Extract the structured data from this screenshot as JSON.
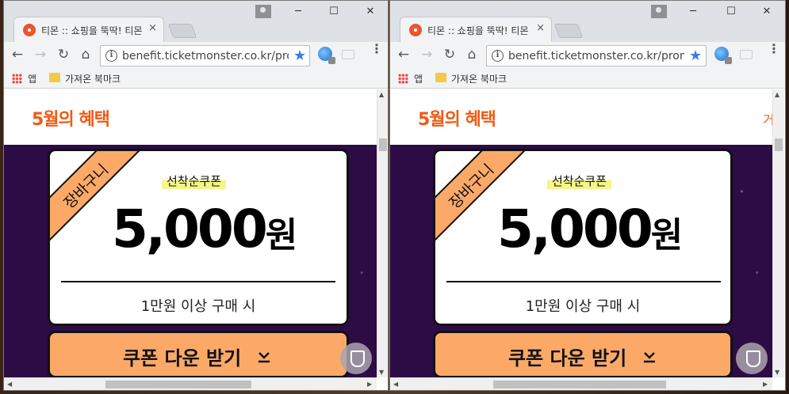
{
  "browser": {
    "tab_title": "티몬 :: 쇼핑을 뚝딱! 티몬",
    "tab_close": "×",
    "url": "benefit.ticketmonster.co.kr/promot",
    "bookmarks": {
      "apps_label": "앱",
      "folder_label": "가져온 북마크"
    },
    "window_controls": {
      "minimize": "─",
      "maximize": "☐",
      "close": "✕"
    },
    "nav": {
      "back": "←",
      "forward": "→",
      "reload": "↻",
      "home": "⌂"
    },
    "star": "★",
    "info": "i",
    "menu": "⋮"
  },
  "page": {
    "promo_title": "5월의 혜택",
    "header_right_partial": "거",
    "coupon": {
      "ribbon_label": "장바구니",
      "tag": "선착순쿠폰",
      "amount": "5,000",
      "amount_unit": "원",
      "condition": "1만원 이상 구매 시"
    },
    "download_button_label": "쿠폰 다운 받기"
  },
  "scroll": {
    "up": "▲",
    "down": "▼",
    "left": "◀",
    "right": "▶"
  },
  "colors": {
    "accent_orange": "#f05a14",
    "coupon_orange": "#fca968",
    "purple_bg": "#2d0b45",
    "highlight_yellow": "#f6f58a"
  }
}
